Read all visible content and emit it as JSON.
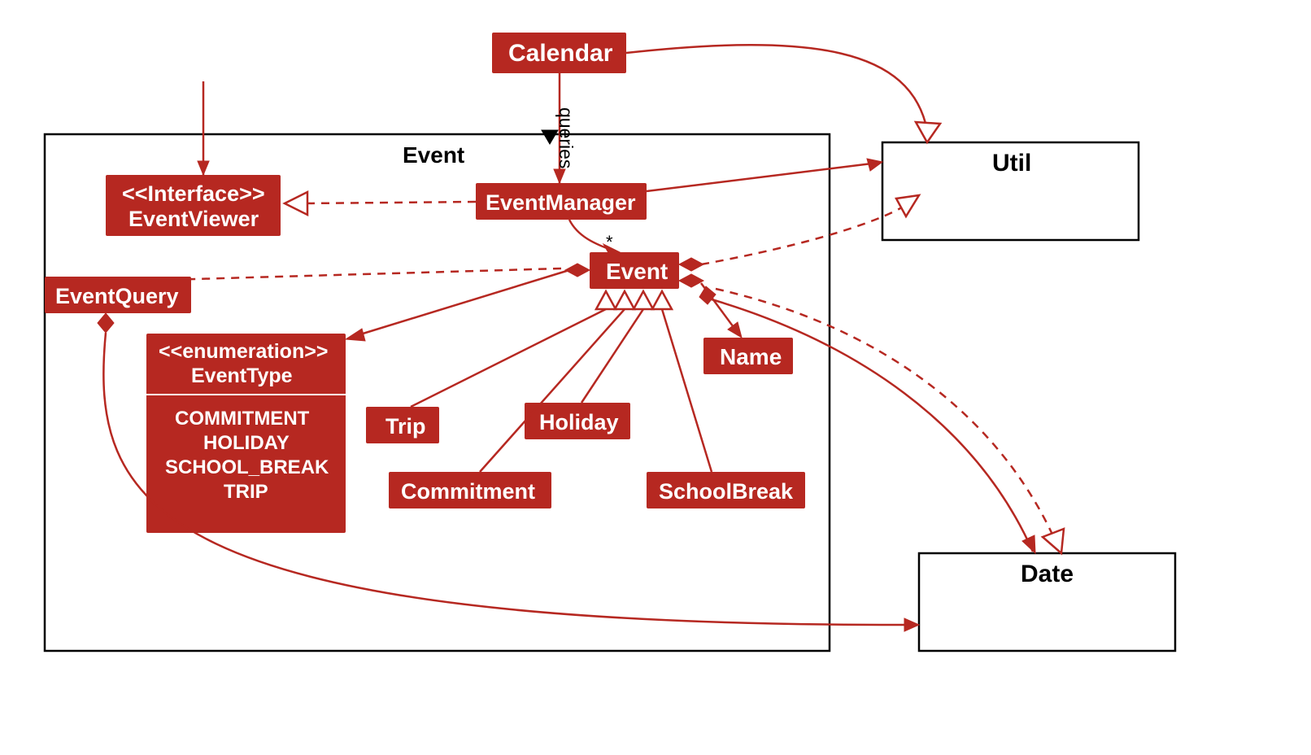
{
  "package": {
    "title": "Event"
  },
  "nodes": {
    "calendar": "Calendar",
    "eventViewer": {
      "stereotype": "<<Interface>>",
      "name": "EventViewer"
    },
    "eventManager": "EventManager",
    "eventQuery": "EventQuery",
    "event": "Event",
    "eventType": {
      "stereotype": "<<enumeration>>",
      "name": "EventType",
      "values": [
        "COMMITMENT",
        "HOLIDAY",
        "SCHOOL_BREAK",
        "TRIP"
      ]
    },
    "trip": "Trip",
    "commitment": "Commitment",
    "holiday": "Holiday",
    "schoolBreak": "SchoolBreak",
    "name": "Name",
    "util": "Util",
    "date": "Date"
  },
  "edges": {
    "queriesLabel": "queries",
    "multiplicityEvent": "*"
  }
}
